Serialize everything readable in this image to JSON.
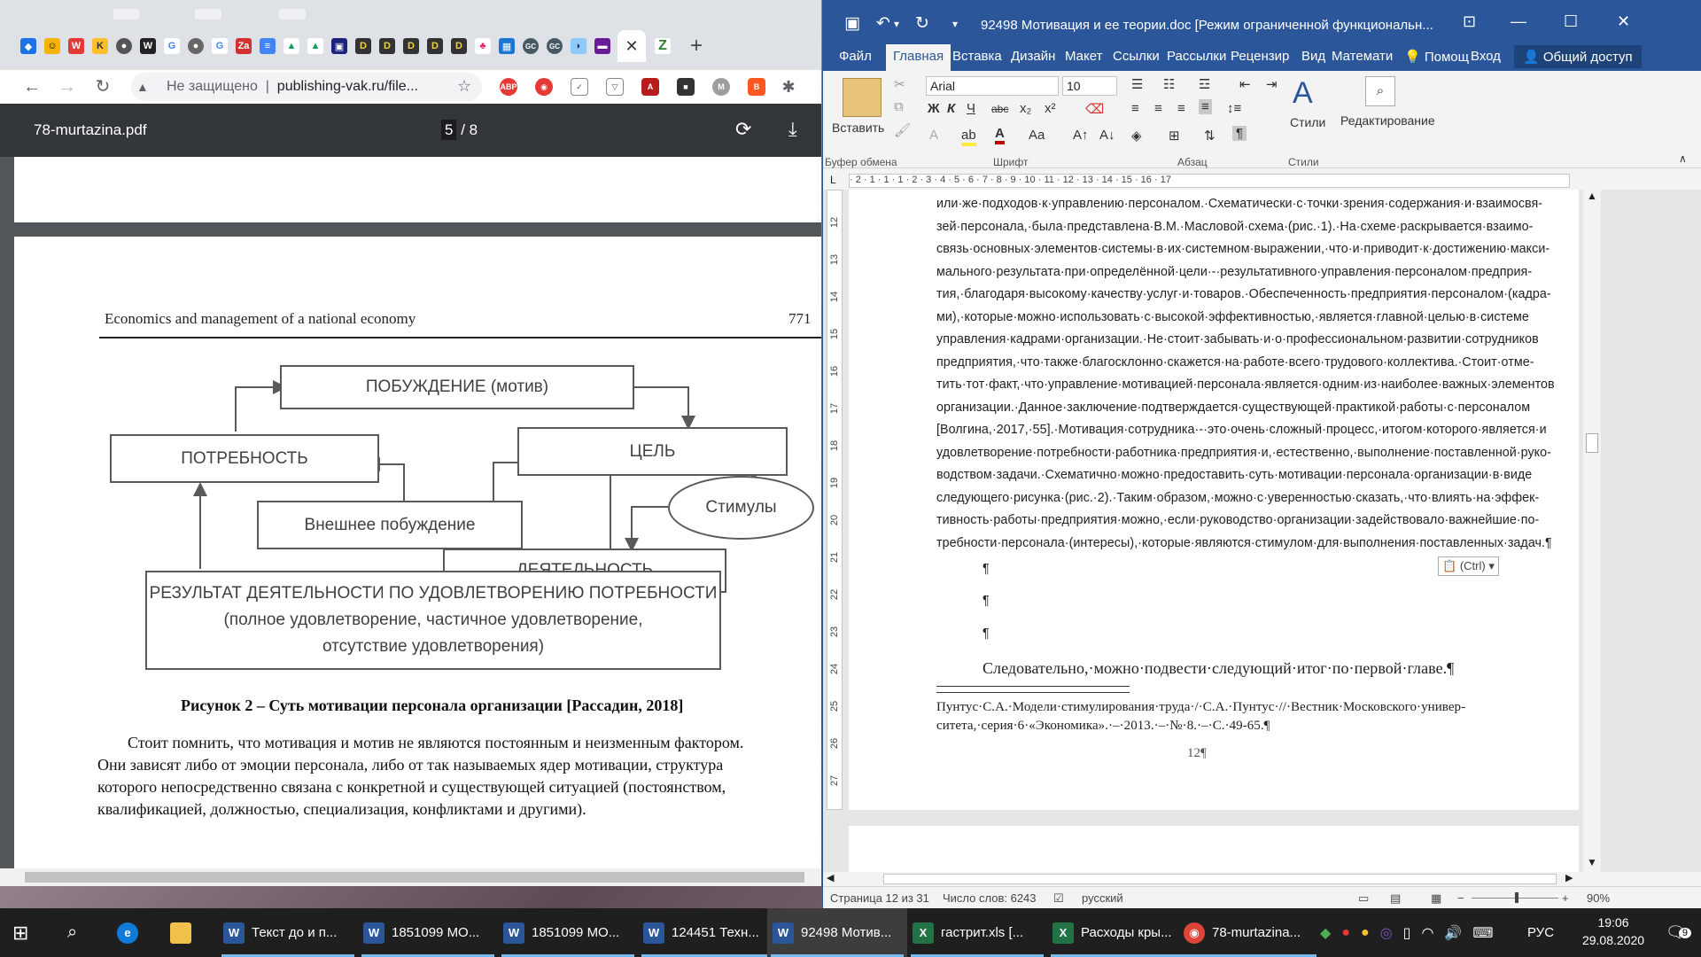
{
  "chrome": {
    "address": {
      "warning": "Не защищено",
      "url": "publishing-vak.ru/file..."
    },
    "pdf": {
      "filename": "78-murtazina.pdf",
      "page_current": "5",
      "page_sep": " / ",
      "page_total": "8",
      "header": "Economics and management of a national economy",
      "page_number": "771",
      "diagram": {
        "motive": "ПОБУЖДЕНИЕ (мотив)",
        "need": "ПОТРЕБНОСТЬ",
        "goal": "ЦЕЛЬ",
        "external": "Внешнее побуждение",
        "stimuli": "Стимулы",
        "activity": "ДЕЯТЕЛЬНОСТЬ",
        "result_1": "РЕЗУЛЬТАТ ДЕЯТЕЛЬНОСТИ ПО УДОВЛЕТВОРЕНИЮ ПОТРЕБНОСТИ",
        "result_2": "(полное удовлетворение, частичное удовлетворение,",
        "result_3": "отсутствие удовлетворения)"
      },
      "caption": "Рисунок 2 – Суть мотивации персонала организации [Рассадин, 2018]",
      "body": [
        "Стоит помнить, что мотивация и мотив не являются постоянным и неизменным фактором.",
        "Они зависят либо от эмоции персонала, либо от так называемых ядер мотивации, структура",
        "которого непосредственно связана с  конкретной и существующей ситуацией (постоянством,",
        "квалификацией, должностью, специализация, конфликтами и другими)."
      ]
    }
  },
  "word": {
    "title": "92498 Мотивация и ее теории.doc [Режим ограниченной функциональн...",
    "tabs": [
      "Файл",
      "Главная",
      "Вставка",
      "Дизайн",
      "Макет",
      "Ссылки",
      "Рассылки",
      "Рецензир",
      "Вид",
      "Математи",
      "Помощ",
      "Вход",
      "Общий доступ"
    ],
    "ribbon": {
      "paste": "Вставить",
      "font": "Arial",
      "size": "10",
      "styles": "Стили",
      "editing": "Редактирование",
      "groups": [
        "Буфер обмена",
        "Шрифт",
        "Абзац",
        "Стили"
      ],
      "bold": "Ж",
      "italic": "К",
      "underline": "Ч",
      "strike": "abc"
    },
    "ruler": "· 2 · 1 · 1 · 1 · 2 · 3 · 4 · 5 · 6 · 7 · 8 · 9 · 10 · 11 · 12 · 13 · 14 · 15 · 16 · 17",
    "vruler": [
      "12",
      "13",
      "14",
      "15",
      "16",
      "17",
      "18",
      "19",
      "20",
      "21",
      "22",
      "23",
      "24",
      "25",
      "26",
      "27"
    ],
    "doc_lines": [
      "или·же·подходов·к·управлению·персоналом.·Схематически·с·точки·зрения·содержания·и·взаимосвя-",
      "зей·персонала,·была·представлена·В.М.·Масловой·схема·(рис.·1).·На·схеме·раскрывается·взаимо-",
      "связь·основных·элементов·системы·в·их·системном·выражении,·что·и·приводит·к·достижению·макси-",
      "мального·результата·при·определённой·цели·-·результативного·управления·персоналом·предприя-",
      "тия,·благодаря·высокому·качеству·услуг·и·товаров.·Обеспеченность·предприятия·персоналом·(кадра-",
      "ми),·которые·можно·использовать·с·высокой·эффективностью,·является·главной·целью·в·системе",
      "управления·кадрами·организации.·Не·стоит·забывать·и·о·профессиональном·развитии·сотрудников",
      "предприятия,·что·также·благосклонно·скажется·на·работе·всего·трудового·коллектива.·Стоит·отме-",
      "тить·тот·факт,·что·управление·мотивацией·персонала·является·одним·из·наиболее·важных·элементов",
      "организации.·Данное·заключение·подтверждается·существующей·практикой·работы·с·персоналом",
      "[Волгина,·2017,·55].·Мотивация·сотрудника·-·это·очень·сложный·процесс,·итогом·которого·является·и",
      "удовлетворение·потребности·работника·предприятия·и,·естественно,·выполнение·поставленной·руко-",
      "водством·задачи.·Схематично·можно·предоставить·суть·мотивации·персонала·организации·в·виде",
      "следующего·рисунка·(рис.·2).·Таким·образом,·можно·с·уверенностью·сказать,·что·влиять·на·эффек-",
      "тивность·работы·предприятия·можно,·если·руководство·организации·задействовало·важнейшие·по-",
      "требности·персонала·(интересы),·которые·являются·стимулом·для·выполнения·поставленных·задач.¶"
    ],
    "empty_para": "¶",
    "paste_opts": "(Ctrl)",
    "conclusion": "Следовательно,·можно·подвести·следующий·итог·по·первой·главе.¶",
    "footnote_1": "Пунтус·С.А.·Модели·стимулирования·труда·/·С.А.·Пунтус·//·Вестник·Московского·универ-",
    "footnote_2": "ситета,·серия·6·«Экономика».·–·2013.·–·№·8.·–·С.·49-65.¶",
    "page_num": "12¶",
    "status": {
      "page": "Страница 12 из 31",
      "words": "Число слов: 6243",
      "lang": "русский",
      "zoom": "90%"
    }
  },
  "taskbar": {
    "items": [
      "Текст до и п...",
      "1851099 МО...",
      "1851099 МО...",
      "124451 Техн...",
      "92498 Мотив...",
      "гастрит.xls [...",
      "Расходы кры...",
      "78-murtazina..."
    ],
    "lang": "РУС",
    "time": "19:06",
    "date": "29.08.2020",
    "notif": "9"
  }
}
